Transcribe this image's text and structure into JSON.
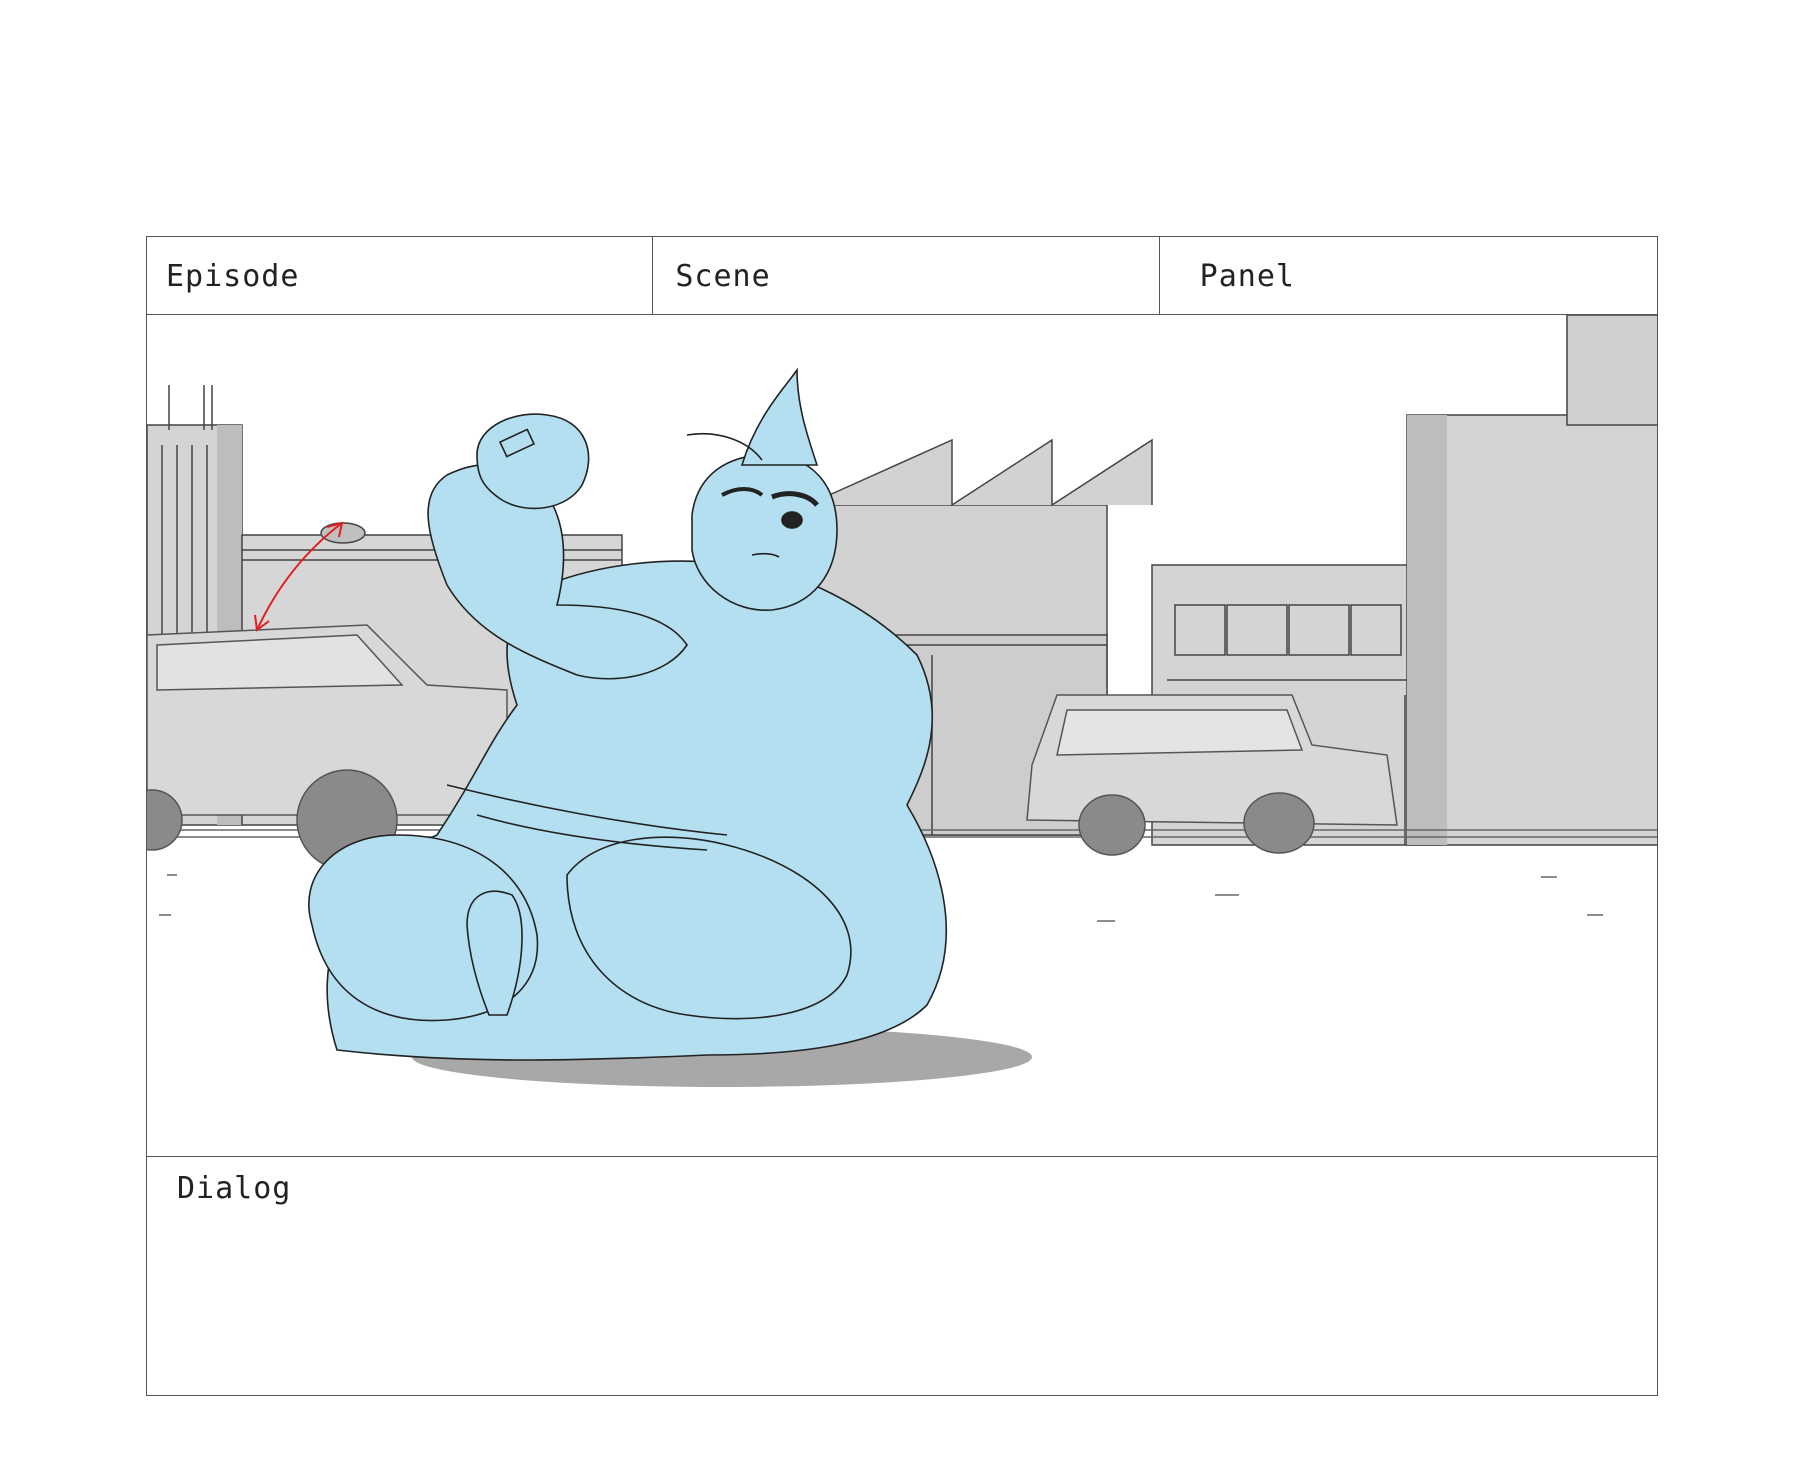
{
  "header": {
    "episode_label": "Episode",
    "scene_label": "Scene",
    "panel_label": "Panel"
  },
  "panel": {
    "colors": {
      "character_fill": "#b3dff0",
      "building_fill": "#d4d4d4",
      "building_dark": "#b8b8b8",
      "wheel": "#8a8a8a",
      "line": "#222222",
      "motion_arrow": "#e02020",
      "shadow": "#a8a8a8"
    }
  },
  "dialog": {
    "label": "Dialog"
  }
}
